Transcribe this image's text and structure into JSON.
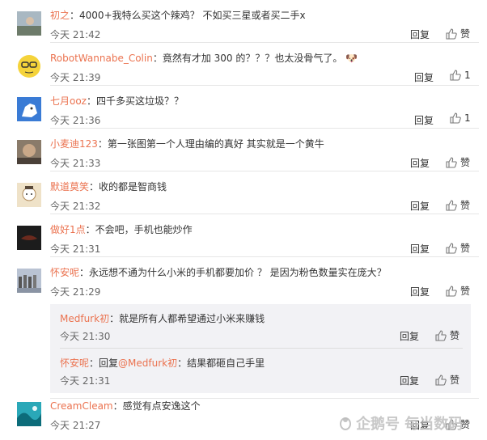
{
  "comments": [
    {
      "user": "初之",
      "text": "4000+我特么买这个辣鸡？ 不如买三星或者买二手x",
      "time": "今天 21:42",
      "reply": "回复",
      "like": "赞"
    },
    {
      "user": "RobotWannabe_Colin",
      "text": "竟然有才加 300 的？？？也太没骨气了。",
      "time": "今天 21:39",
      "reply": "回复",
      "like": "1",
      "emoji": "🐶"
    },
    {
      "user": "七月ooz",
      "text": "四千多买这垃圾？？",
      "time": "今天 21:36",
      "reply": "回复",
      "like": "1"
    },
    {
      "user": "小麦迪123",
      "text": "第一张图第一个人理由编的真好 其实就是一个黄牛",
      "time": "今天 21:33",
      "reply": "回复",
      "like": "赞"
    },
    {
      "user": "默道莫笑",
      "text": "收的都是智商钱",
      "time": "今天 21:32",
      "reply": "回复",
      "like": "赞"
    },
    {
      "user": "做好1点",
      "text": "不会吧，手机也能炒作",
      "time": "今天 21:31",
      "reply": "回复",
      "like": "赞"
    },
    {
      "user": "怀安呢",
      "text": "永远想不通为什么小米的手机都要加价 ？ 是因为粉色数量实在庞大？",
      "time": "今天 21:29",
      "reply": "回复",
      "like": "赞"
    },
    {
      "user": "CreamCleam",
      "text": "感觉有点安逸这个",
      "time": "今天 21:27",
      "reply": "回复",
      "like": "赞"
    }
  ],
  "subreplies": [
    {
      "user": "Medfurk初",
      "text": "就是所有人都希望通过小米来赚钱",
      "time": "今天 21:30",
      "reply": "回复",
      "like": "赞"
    },
    {
      "user": "怀安呢",
      "prefix": "回复",
      "mention": "@Medfurk初",
      "text": "结果都砸自己手里",
      "time": "今天 21:31",
      "reply": "回复",
      "like": "赞"
    }
  ],
  "separator": "：",
  "watermark": {
    "text": "企鹅号 每当数码"
  },
  "colors": {
    "username": "#eb7350",
    "divider": "#e6e6e6",
    "subbox": "#f2f2f5"
  }
}
